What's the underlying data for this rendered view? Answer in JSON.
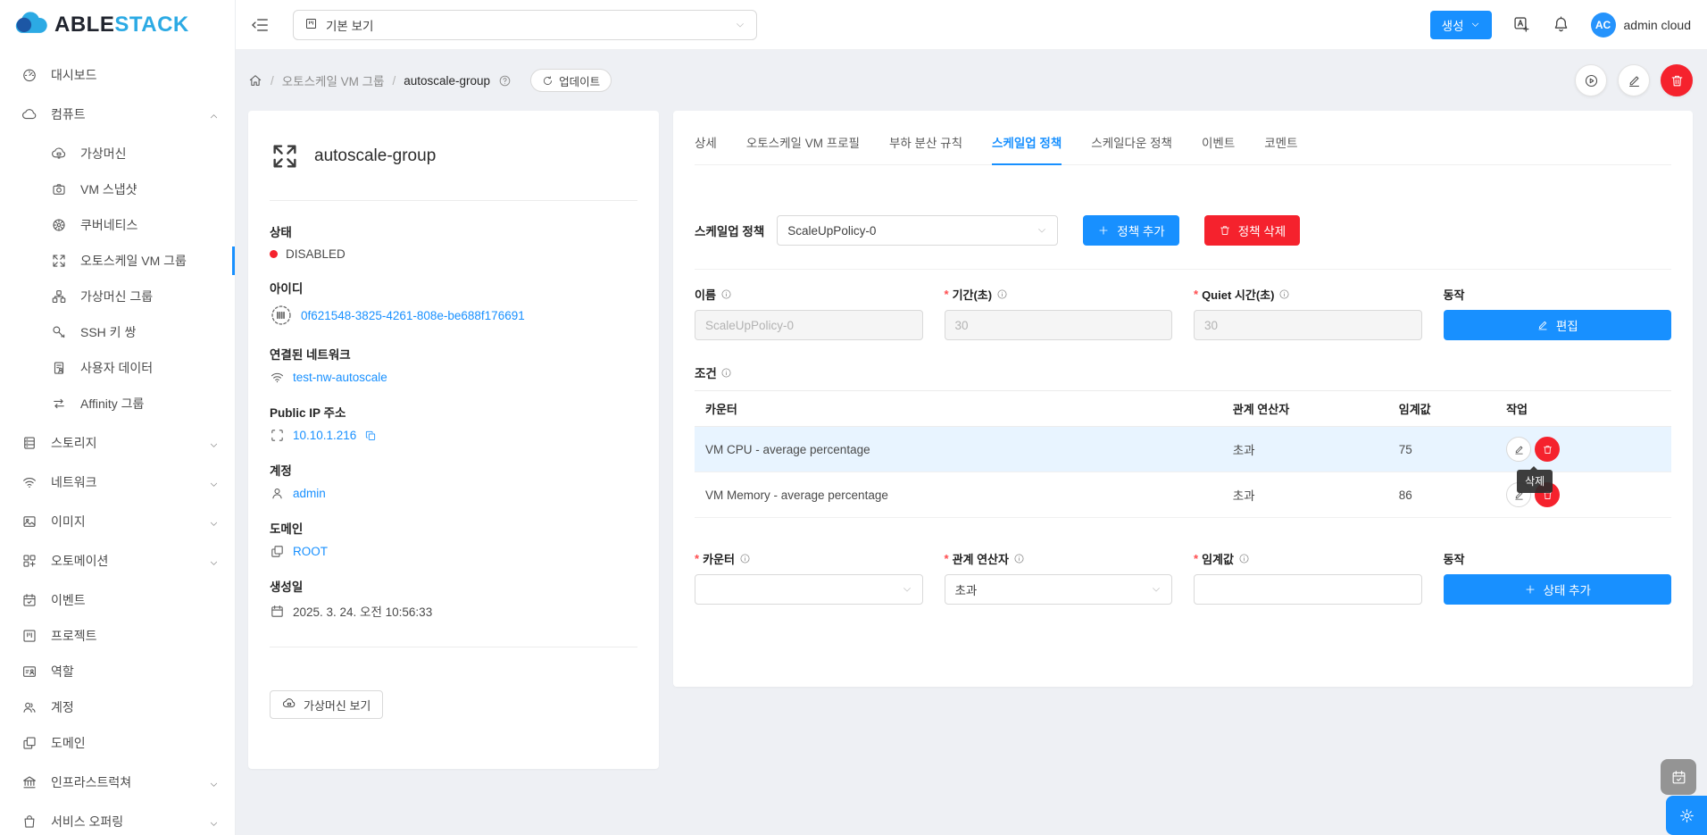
{
  "brand": {
    "name_left": "ABLE",
    "name_right": "STACK"
  },
  "topbar": {
    "view_select": "기본 보기",
    "create_button": "생성",
    "avatar": "AC",
    "username": "admin cloud"
  },
  "breadcrumb": {
    "separator": "/",
    "parent": "오토스케일 VM 그룹",
    "current": "autoscale-group",
    "update_button": "업데이트"
  },
  "sidebar": {
    "items": [
      {
        "label": "대시보드"
      },
      {
        "label": "컴퓨트"
      },
      {
        "label": "가상머신"
      },
      {
        "label": "VM 스냅샷"
      },
      {
        "label": "쿠버네티스"
      },
      {
        "label": "오토스케일 VM 그룹",
        "active": true
      },
      {
        "label": "가상머신 그룹"
      },
      {
        "label": "SSH 키 쌍"
      },
      {
        "label": "사용자 데이터"
      },
      {
        "label": "Affinity 그룹"
      },
      {
        "label": "스토리지"
      },
      {
        "label": "네트워크"
      },
      {
        "label": "이미지"
      },
      {
        "label": "오토메이션"
      },
      {
        "label": "이벤트"
      },
      {
        "label": "프로젝트"
      },
      {
        "label": "역할"
      },
      {
        "label": "계정"
      },
      {
        "label": "도메인"
      },
      {
        "label": "인프라스트럭쳐"
      },
      {
        "label": "서비스 오퍼링"
      }
    ]
  },
  "info": {
    "title": "autoscale-group",
    "status_label": "상태",
    "status_value": "DISABLED",
    "status_color": "#f5222d",
    "id_label": "아이디",
    "id_value": "0f621548-3825-4261-808e-be688f176691",
    "network_label": "연결된 네트워크",
    "network_value": "test-nw-autoscale",
    "ip_label": "Public IP 주소",
    "ip_value": "10.10.1.216",
    "account_label": "계정",
    "account_value": "admin",
    "domain_label": "도메인",
    "domain_value": "ROOT",
    "created_label": "생성일",
    "created_value": "2025. 3. 24. 오전 10:56:33",
    "view_vm_button": "가상머신 보기"
  },
  "tabs": [
    {
      "label": "상세"
    },
    {
      "label": "오토스케일 VM 프로필"
    },
    {
      "label": "부하 분산 규칙"
    },
    {
      "label": "스케일업 정책",
      "active": true
    },
    {
      "label": "스케일다운 정책"
    },
    {
      "label": "이벤트"
    },
    {
      "label": "코멘트"
    }
  ],
  "policy": {
    "label": "스케일업 정책",
    "selected": "ScaleUpPolicy-0",
    "add_button": "정책 추가",
    "delete_button": "정책 삭제",
    "required_mark": "*",
    "name_label": "이름",
    "name_value": "ScaleUpPolicy-0",
    "duration_label": "기간(초)",
    "duration_value": "30",
    "quiet_label": "Quiet 시간(초)",
    "quiet_value": "30",
    "action_label": "동작",
    "edit_button": "편집"
  },
  "condition": {
    "label": "조건",
    "columns": [
      "카운터",
      "관계 연산자",
      "임계값",
      "작업"
    ],
    "rows": [
      {
        "counter": "VM CPU - average percentage",
        "operator": "초과",
        "threshold": "75"
      },
      {
        "counter": "VM Memory - average percentage",
        "operator": "초과",
        "threshold": "86"
      }
    ],
    "delete_tooltip": "삭제",
    "form": {
      "counter_label": "카운터",
      "operator_label": "관계 연산자",
      "operator_value": "초과",
      "threshold_label": "임계값",
      "action_label": "동작",
      "add_button": "상태 추가"
    }
  },
  "colors": {
    "primary": "#1890ff",
    "danger": "#f5222d",
    "link": "#1890ff"
  }
}
